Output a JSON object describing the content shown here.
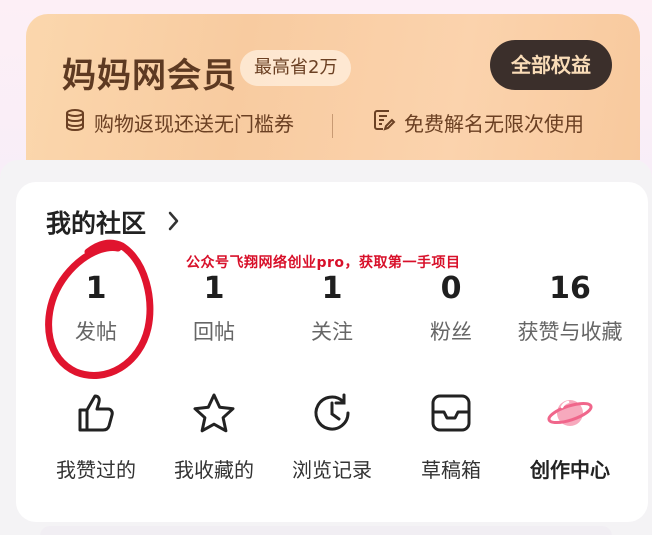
{
  "vip": {
    "title": "妈妈网会员",
    "badge": "最高省2万",
    "button": "全部权益",
    "perks": [
      {
        "icon": "coins-icon",
        "label": "购物返现还送无门槛券"
      },
      {
        "icon": "edit-note-icon",
        "label": "免费解名无限次使用"
      }
    ]
  },
  "community": {
    "title": "我的社区",
    "stats": [
      {
        "value": "1",
        "label": "发帖"
      },
      {
        "value": "1",
        "label": "回帖"
      },
      {
        "value": "1",
        "label": "关注"
      },
      {
        "value": "0",
        "label": "粉丝"
      },
      {
        "value": "16",
        "label": "获赞与收藏"
      }
    ],
    "tools": [
      {
        "icon": "thumbs-up-icon",
        "label": "我赞过的"
      },
      {
        "icon": "star-icon",
        "label": "我收藏的"
      },
      {
        "icon": "history-clock-icon",
        "label": "浏览记录"
      },
      {
        "icon": "inbox-icon",
        "label": "草稿箱"
      },
      {
        "icon": "planet-icon",
        "label": "创作中心"
      }
    ]
  },
  "overlay_text": "公众号飞翔网络创业pro，获取第一手项目",
  "colors": {
    "vip_bg": "#f9cfa6",
    "vip_text": "#5e3a22",
    "vip_button_bg": "#3b2f2b",
    "planet_accent": "#f0668b",
    "annotation_red": "#d8102a"
  }
}
